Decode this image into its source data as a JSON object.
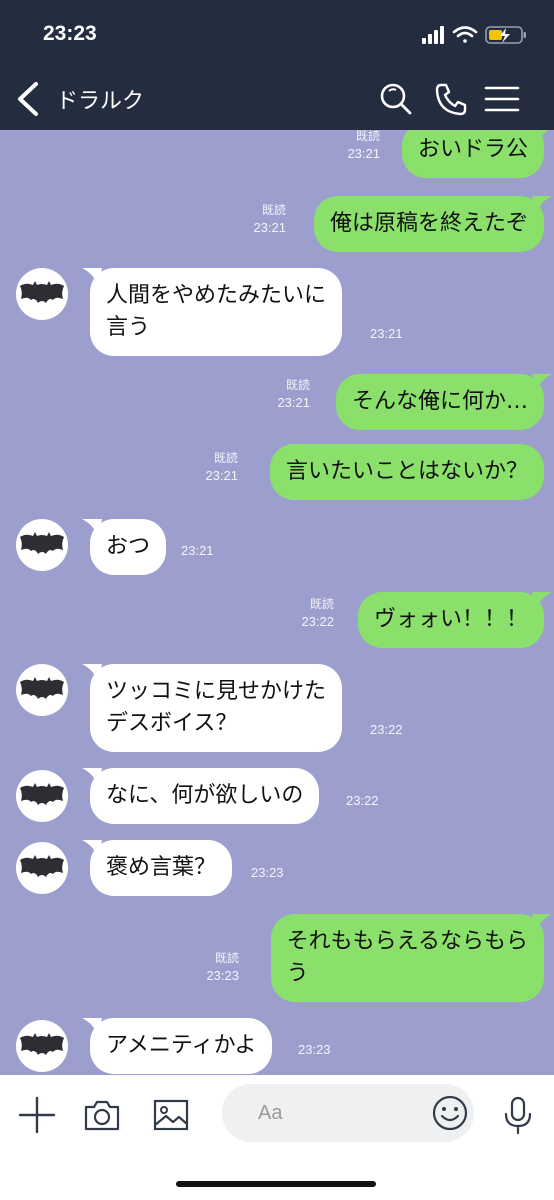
{
  "status_bar": {
    "time": "23:23"
  },
  "header": {
    "title": "ドラルク"
  },
  "chat": {
    "messages": [
      {
        "dir": "out",
        "lines": [
          "おいドラ公"
        ],
        "read": "既読",
        "time": "23:21"
      },
      {
        "dir": "out",
        "lines": [
          "俺は原稿を終えたぞ"
        ],
        "read": "既読",
        "time": "23:21"
      },
      {
        "dir": "in",
        "lines": [
          "人間をやめたみたいに",
          "言う"
        ],
        "time": "23:21"
      },
      {
        "dir": "out",
        "lines": [
          "そんな俺に何か…"
        ],
        "read": "既読",
        "time": "23:21"
      },
      {
        "dir": "out",
        "lines": [
          "言いたいことはないか？"
        ],
        "read": "既読",
        "time": "23:21"
      },
      {
        "dir": "in",
        "lines": [
          "おつ"
        ],
        "time": "23:21"
      },
      {
        "dir": "out",
        "lines": [
          "ヴォォい！！！"
        ],
        "read": "既読",
        "time": "23:22"
      },
      {
        "dir": "in",
        "lines": [
          "ツッコミに見せかけた",
          "デスボイス？"
        ],
        "time": "23:22"
      },
      {
        "dir": "in",
        "lines": [
          "なに、何が欲しいの"
        ],
        "time": "23:22"
      },
      {
        "dir": "in",
        "lines": [
          "褒め言葉？"
        ],
        "time": "23:23"
      },
      {
        "dir": "out",
        "lines": [
          "それももらえるならもら",
          "う"
        ],
        "read": "既読",
        "time": "23:23"
      },
      {
        "dir": "in",
        "lines": [
          "アメニティかよ"
        ],
        "time": "23:23"
      }
    ]
  },
  "input_bar": {
    "placeholder": "Aa"
  },
  "colors": {
    "header": "#242c3f",
    "chat_bg": "#9c9fcd",
    "outgoing": "#8ae06a",
    "incoming": "#ffffff"
  },
  "icons": [
    "back-icon",
    "search-icon",
    "phone-icon",
    "menu-icon",
    "plus-icon",
    "camera-icon",
    "image-icon",
    "smiley-icon",
    "mic-icon",
    "bat-avatar-icon"
  ]
}
